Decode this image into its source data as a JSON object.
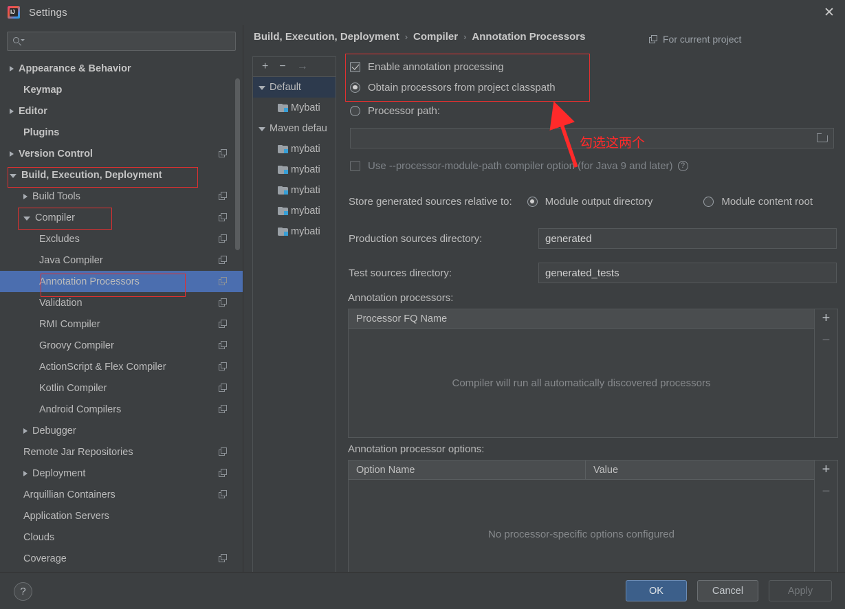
{
  "window": {
    "title": "Settings",
    "app_icon": "intellij-idea-icon",
    "close_icon": "close-icon"
  },
  "sidebar": {
    "search": {
      "placeholder": "",
      "value": "",
      "icon": "search-icon"
    },
    "items": [
      {
        "label": "Appearance & Behavior",
        "arrow": "right",
        "indent": 0,
        "bold": true,
        "copy": false,
        "selected": false
      },
      {
        "label": "Keymap",
        "arrow": "none",
        "indent": 1,
        "bold": true,
        "copy": false,
        "selected": false
      },
      {
        "label": "Editor",
        "arrow": "right",
        "indent": 0,
        "bold": true,
        "copy": false,
        "selected": false
      },
      {
        "label": "Plugins",
        "arrow": "none",
        "indent": 1,
        "bold": true,
        "copy": false,
        "selected": false
      },
      {
        "label": "Version Control",
        "arrow": "right",
        "indent": 0,
        "bold": true,
        "copy": true,
        "selected": false
      },
      {
        "label": "Build, Execution, Deployment",
        "arrow": "down",
        "indent": 0,
        "bold": true,
        "copy": false,
        "selected": false
      },
      {
        "label": "Build Tools",
        "arrow": "right",
        "indent": 1,
        "bold": false,
        "copy": true,
        "selected": false
      },
      {
        "label": "Compiler",
        "arrow": "down",
        "indent": 1,
        "bold": false,
        "copy": true,
        "selected": false
      },
      {
        "label": "Excludes",
        "arrow": "none",
        "indent": 2,
        "bold": false,
        "copy": true,
        "selected": false
      },
      {
        "label": "Java Compiler",
        "arrow": "none",
        "indent": 2,
        "bold": false,
        "copy": true,
        "selected": false
      },
      {
        "label": "Annotation Processors",
        "arrow": "none",
        "indent": 2,
        "bold": false,
        "copy": true,
        "selected": true
      },
      {
        "label": "Validation",
        "arrow": "none",
        "indent": 2,
        "bold": false,
        "copy": true,
        "selected": false
      },
      {
        "label": "RMI Compiler",
        "arrow": "none",
        "indent": 2,
        "bold": false,
        "copy": true,
        "selected": false
      },
      {
        "label": "Groovy Compiler",
        "arrow": "none",
        "indent": 2,
        "bold": false,
        "copy": true,
        "selected": false
      },
      {
        "label": "ActionScript & Flex Compiler",
        "arrow": "none",
        "indent": 2,
        "bold": false,
        "copy": true,
        "selected": false
      },
      {
        "label": "Kotlin Compiler",
        "arrow": "none",
        "indent": 2,
        "bold": false,
        "copy": true,
        "selected": false
      },
      {
        "label": "Android Compilers",
        "arrow": "none",
        "indent": 2,
        "bold": false,
        "copy": true,
        "selected": false
      },
      {
        "label": "Debugger",
        "arrow": "right",
        "indent": 1,
        "bold": false,
        "copy": false,
        "selected": false
      },
      {
        "label": "Remote Jar Repositories",
        "arrow": "none",
        "indent": 1,
        "bold": false,
        "copy": true,
        "selected": false
      },
      {
        "label": "Deployment",
        "arrow": "right",
        "indent": 1,
        "bold": false,
        "copy": true,
        "selected": false
      },
      {
        "label": "Arquillian Containers",
        "arrow": "none",
        "indent": 1,
        "bold": false,
        "copy": true,
        "selected": false
      },
      {
        "label": "Application Servers",
        "arrow": "none",
        "indent": 1,
        "bold": false,
        "copy": false,
        "selected": false
      },
      {
        "label": "Clouds",
        "arrow": "none",
        "indent": 1,
        "bold": false,
        "copy": false,
        "selected": false
      },
      {
        "label": "Coverage",
        "arrow": "none",
        "indent": 1,
        "bold": false,
        "copy": true,
        "selected": false
      }
    ]
  },
  "header": {
    "breadcrumb": [
      "Build, Execution, Deployment",
      "Compiler",
      "Annotation Processors"
    ],
    "separator": "›",
    "for_current_project": "For current project"
  },
  "profiles": {
    "toolbar": {
      "add": "+",
      "remove": "−",
      "move": "→"
    },
    "items": [
      {
        "label": "Default",
        "arrow": "down",
        "indent": 0,
        "folder": false,
        "selected": true
      },
      {
        "label": "Mybati",
        "arrow": "none",
        "indent": 1,
        "folder": true,
        "selected": false
      },
      {
        "label": "Maven defau",
        "arrow": "down",
        "indent": 0,
        "folder": false,
        "selected": false
      },
      {
        "label": "mybati",
        "arrow": "none",
        "indent": 1,
        "folder": true,
        "selected": false
      },
      {
        "label": "mybati",
        "arrow": "none",
        "indent": 1,
        "folder": true,
        "selected": false
      },
      {
        "label": "mybati",
        "arrow": "none",
        "indent": 1,
        "folder": true,
        "selected": false
      },
      {
        "label": "mybati",
        "arrow": "none",
        "indent": 1,
        "folder": true,
        "selected": false
      },
      {
        "label": "mybati",
        "arrow": "none",
        "indent": 1,
        "folder": true,
        "selected": false
      }
    ]
  },
  "settings": {
    "enable_annotation_processing": {
      "label": "Enable annotation processing",
      "checked": true
    },
    "obtain_from_classpath": {
      "label": "Obtain processors from project classpath",
      "selected": true
    },
    "processor_path": {
      "label": "Processor path:",
      "selected": false,
      "value": "",
      "browse_icon": "folder-browse-icon"
    },
    "use_module_path": {
      "label": "Use --processor-module-path compiler option (for Java 9 and later)",
      "checked": false,
      "help_icon": "help-circle-icon"
    },
    "store_relative": {
      "label": "Store generated sources relative to:",
      "option_module_output": "Module output directory",
      "option_content_root": "Module content root",
      "selected": "Module output directory"
    },
    "production_sources": {
      "label": "Production sources directory:",
      "value": "generated"
    },
    "test_sources": {
      "label": "Test sources directory:",
      "value": "generated_tests"
    },
    "processors_table": {
      "label": "Annotation processors:",
      "columns": [
        "Processor FQ Name"
      ],
      "rows": [],
      "empty_text": "Compiler will run all automatically discovered processors",
      "add": "+",
      "remove": "−"
    },
    "options_table": {
      "label": "Annotation processor options:",
      "columns": [
        "Option Name",
        "Value"
      ],
      "rows": [],
      "empty_text": "No processor-specific options configured",
      "add": "+",
      "remove": "−"
    }
  },
  "footer": {
    "help": "?",
    "ok": "OK",
    "cancel": "Cancel",
    "apply": "Apply"
  },
  "annotations": {
    "note_text": "勾选这两个",
    "color": "#ff2a2a"
  },
  "colors": {
    "background": "#3c3f41",
    "selection_blue": "#4b6eaf",
    "profile_selection": "#2d3a4d",
    "ok_button": "#3c5f8a",
    "annotation_red": "#ff2a2a",
    "folder_badge": "#389fd6"
  }
}
